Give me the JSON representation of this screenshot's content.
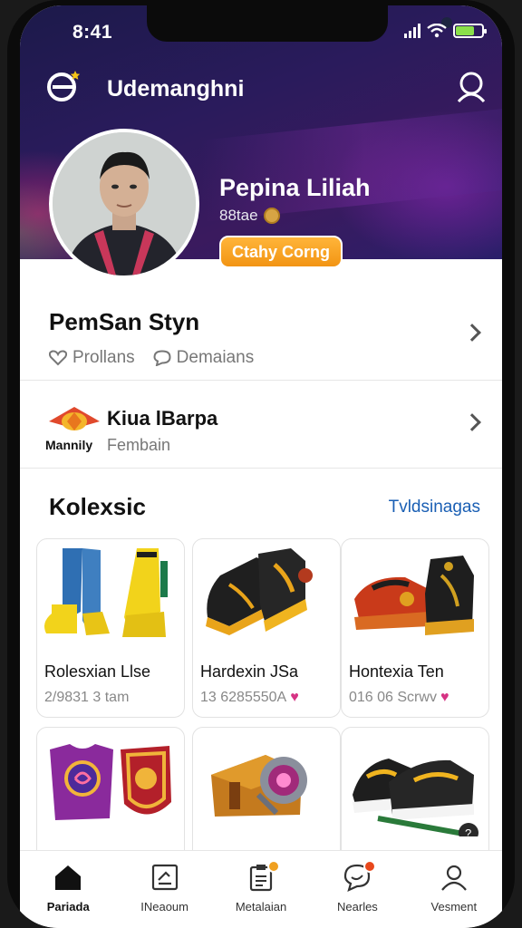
{
  "status": {
    "time": "8:41"
  },
  "header": {
    "app_title": "Udemanghni"
  },
  "profile": {
    "name": "Pepina Liliah",
    "subtitle": "88tae",
    "badge": "Ctahy Corng"
  },
  "row_main": {
    "title": "PemSan Styn",
    "meta": [
      "Prollans",
      "Demaians"
    ]
  },
  "row_game": {
    "icon_caption": "Mannily",
    "title": "Kiua lBarpa",
    "subtitle": "Fembain"
  },
  "collection": {
    "title": "Kolexsic",
    "see_all": "Tvldsinagas",
    "items": [
      {
        "name": "Rolesxian Llse",
        "price": "2/9831 3 tam",
        "liked": false
      },
      {
        "name": "Hardexin JSa",
        "price": "13 6285550A",
        "liked": true
      },
      {
        "name": "Hontexia Ten",
        "price": "016 06 Scrwv",
        "liked": true
      },
      {
        "name": "",
        "price": "",
        "liked": false
      },
      {
        "name": "",
        "price": "",
        "liked": false
      },
      {
        "name": "",
        "price": "",
        "liked": false
      }
    ]
  },
  "tabs": [
    {
      "label": "Pariada",
      "icon": "home-icon",
      "active": true
    },
    {
      "label": "INeaoum",
      "icon": "profile-card-icon",
      "active": false
    },
    {
      "label": "Metalaian",
      "icon": "clipboard-icon",
      "active": false,
      "badge": "orange"
    },
    {
      "label": "Nearles",
      "icon": "chat-icon",
      "active": false,
      "badge": "red"
    },
    {
      "label": "Vesment",
      "icon": "user-icon",
      "active": false
    }
  ],
  "colors": {
    "accent_orange": "#f29413",
    "link_blue": "#1a5fb4",
    "heart_pink": "#d63384"
  }
}
